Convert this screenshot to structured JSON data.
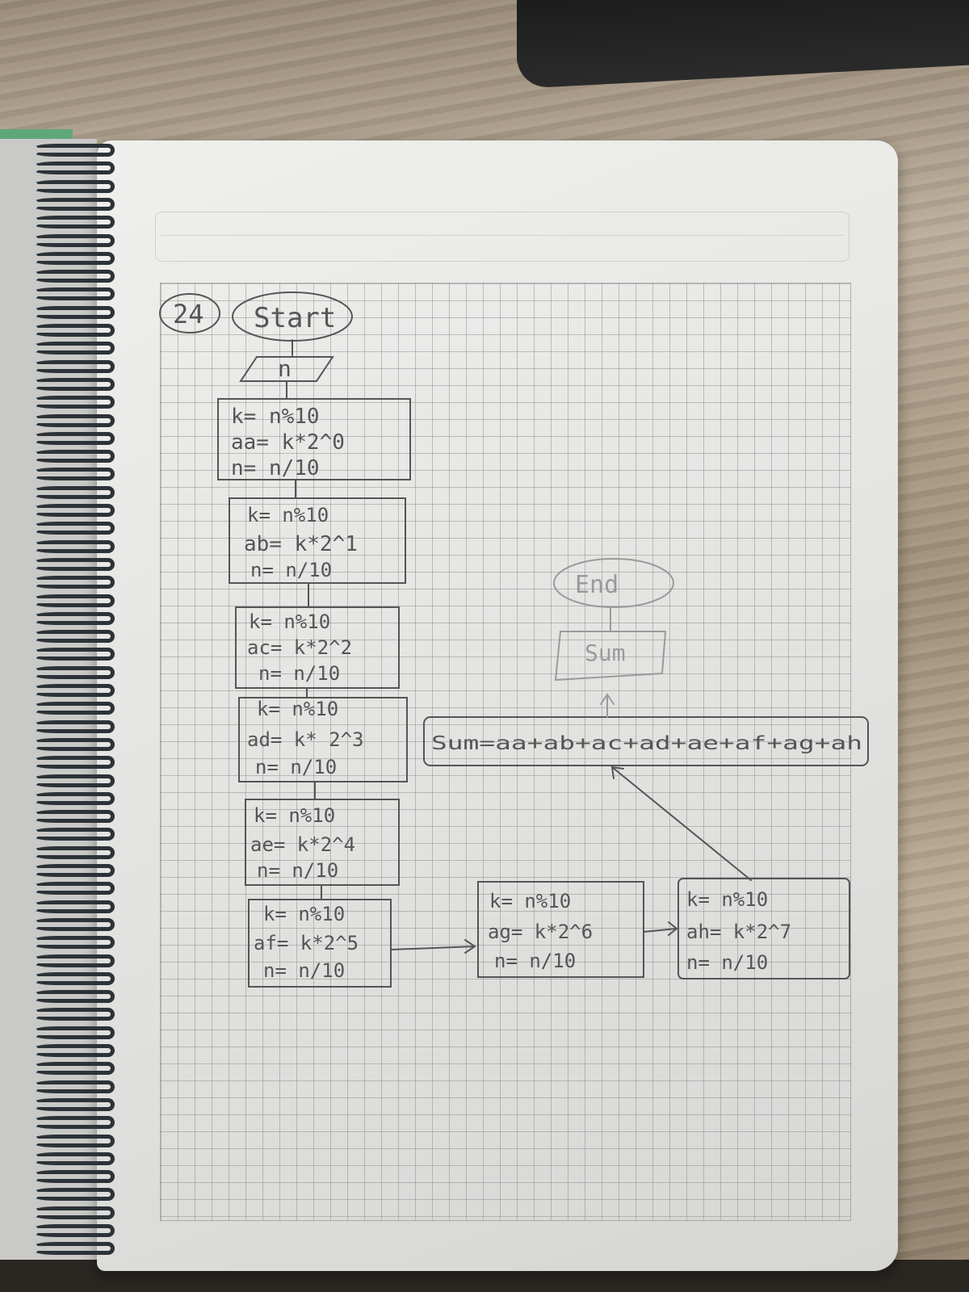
{
  "diagram": {
    "number": "24",
    "start_label": "Start",
    "input_label": "n",
    "blocks": [
      {
        "lines": [
          "k= n%10",
          "aa= k*2^0",
          "n= n/10"
        ]
      },
      {
        "lines": [
          "k= n%10",
          "ab= k*2^1",
          "n= n/10"
        ]
      },
      {
        "lines": [
          "k= n%10",
          "ac= k*2^2",
          "n= n/10"
        ]
      },
      {
        "lines": [
          "k= n%10",
          "ad= k* 2^3",
          "n= n/10"
        ]
      },
      {
        "lines": [
          "k= n%10",
          "ae= k*2^4",
          "n= n/10"
        ]
      },
      {
        "lines": [
          "k= n%10",
          "af= k*2^5",
          "n= n/10"
        ]
      },
      {
        "lines": [
          "k= n%10",
          "ag= k*2^6",
          "n= n/10"
        ]
      },
      {
        "lines": [
          "k= n%10",
          "ah= k*2^7",
          "n= n/10"
        ]
      }
    ],
    "sum_formula": "Sum=aa+ab+ac+ad+ae+af+ag+ah",
    "output_label": "Sum",
    "end_label": "End"
  },
  "colors": {
    "pencil": "#555555",
    "pencil_faint": "#9a9a9a",
    "paper": "#e6e6e4",
    "spiral": "#2c3338"
  }
}
